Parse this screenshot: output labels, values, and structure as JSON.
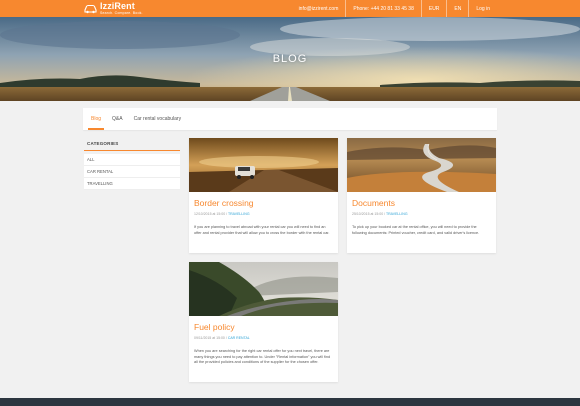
{
  "brand": {
    "name": "IzziRent",
    "tagline": "Search. Compare. Book.",
    "color": "#f7882f"
  },
  "topnav": {
    "email": "info@izzirent.com",
    "phone": "Phone: +44 20 81 33 45 38",
    "currency": "EUR",
    "language": "EN",
    "login": "Log in"
  },
  "hero": {
    "title": "BLOG"
  },
  "tabs": [
    {
      "label": "Blog",
      "active": true
    },
    {
      "label": "Q&A",
      "active": false
    },
    {
      "label": "Car rental vocabulary",
      "active": false
    }
  ],
  "sidebar": {
    "title": "CATEGORIES",
    "items": [
      "ALL",
      "CAR RENTAL",
      "TRAVELLING"
    ]
  },
  "posts": [
    {
      "title": "Border crossing",
      "date": "12/10/2015 at 15:00 /",
      "category": "TRAVELLING",
      "excerpt": "If you are planning to travel abroad with your rental car you will need to find an offer and rental provider that will allow you to cross the border with the rental car."
    },
    {
      "title": "Documents",
      "date": "25/10/2015 at 15:00 /",
      "category": "TRAVELLING",
      "excerpt": "To pick up your booked car at the rental office, you will need to provide the following documents: Printed voucher, credit card, and valid driver's licence."
    },
    {
      "title": "Fuel policy",
      "date": "09/11/2015 at 15:00 /",
      "category": "CAR RENTAL",
      "excerpt": "When you are searching for the right car rental offer for you next travel, there are many things you need to pay attention to. Under \"Rental information\" you will find all the provided policies and conditions of the supplier for the chosen offer."
    }
  ],
  "icons": {
    "logo": "car-icon"
  },
  "colors": {
    "accent": "#f7882f",
    "link": "#2ea3d6",
    "footer": "#2c3640",
    "background": "#f1f1f1"
  }
}
